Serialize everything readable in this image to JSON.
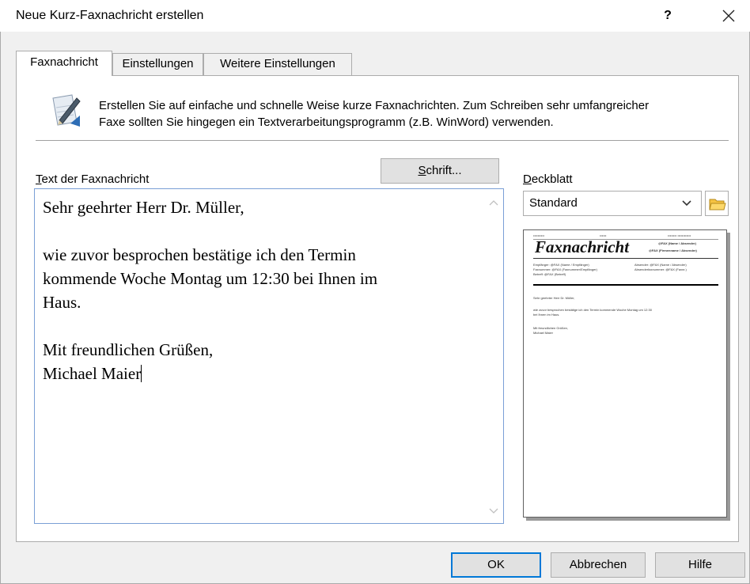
{
  "window": {
    "title": "Neue Kurz-Faxnachricht erstellen",
    "help_label": "?"
  },
  "tabs": [
    {
      "label": "Faxnachricht",
      "active": true
    },
    {
      "label": "Einstellungen",
      "active": false
    },
    {
      "label": "Weitere Einstellungen",
      "active": false
    }
  ],
  "info": {
    "icon": "pen-paper-icon",
    "line1": "Erstellen Sie auf einfache und schnelle Weise kurze Faxnachrichten. Zum Schreiben sehr umfangreicher",
    "line2": "Faxe sollten Sie hingegen ein Textverarbeitungsprogramm (z.B. WinWord) verwenden."
  },
  "message": {
    "label_first": "T",
    "label_rest": "ext der Faxnachricht",
    "font_button_first": "S",
    "font_button_rest": "chrift...",
    "lines": [
      "Sehr geehrter Herr Dr. Müller,",
      "",
      "wie zuvor besprochen bestätige ich den Termin",
      "kommende Woche Montag um 12:30 bei Ihnen im",
      "Haus.",
      "",
      "Mit freundlichen Grüßen,",
      "Michael Maier"
    ]
  },
  "cover": {
    "label_first": "D",
    "label_rest": "eckblatt",
    "selected": "Standard",
    "preview": {
      "heading": "Faxnachricht",
      "top_left": "••••••••••",
      "top_mid": "••••••",
      "top_right": "••••••••  ••••••••••••",
      "right1": "@FAX (Name / Absender)",
      "right2": "@FAX (Firmenname / Absender)",
      "fields_left": [
        "Empfänger: @FAX (Name / Empfänger)",
        "Faxnummer: @FAX (Faxnummer/Empfänger)",
        "Betreff:   @FAX (Betreff)"
      ],
      "fields_right": [
        "Absender: @FAX (Name / Absender)",
        "Absenderfaxnummer: @FAX (Faxnr.)"
      ],
      "body1": "Sehr geehrter Herr Dr. Müller,",
      "body2": "wie zuvor besprochen bestätige ich den Termin kommende Woche Montag um 12:30",
      "body3": "bei Ihnen im Haus.",
      "body4": "Mit freundlichen Grüßen,",
      "body5": "Michael Maier"
    }
  },
  "buttons": {
    "ok": "OK",
    "cancel": "Abbrechen",
    "help": "Hilfe"
  },
  "colors": {
    "accent": "#0078d7",
    "textarea_border": "#7a9fd6",
    "folder": "#f5c342"
  }
}
